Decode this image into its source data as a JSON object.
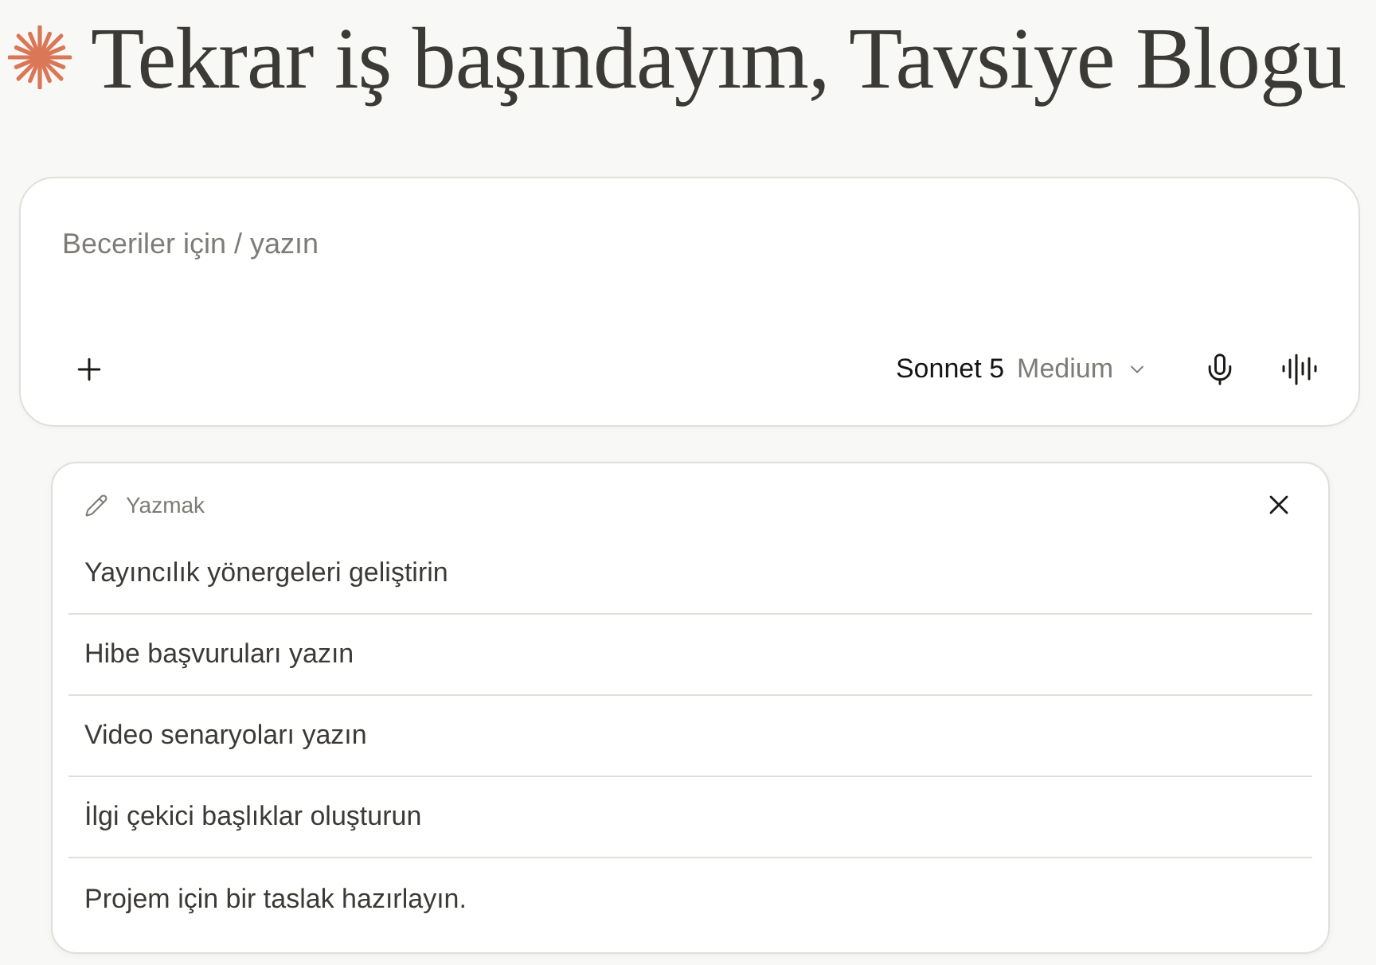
{
  "header": {
    "title": "Tekrar iş başındayım, Tavsiye Blogu"
  },
  "composer": {
    "placeholder": "Beceriler için / yazın",
    "model": "Sonnet 5",
    "effort": "Medium"
  },
  "suggestions": {
    "category": "Yazmak",
    "items": [
      "Yayıncılık yönergeleri geliştirin",
      "Hibe başvuruları yazın",
      "Video senaryoları yazın",
      "İlgi çekici başlıklar oluşturun",
      "Projem için bir taslak hazırlayın."
    ]
  }
}
